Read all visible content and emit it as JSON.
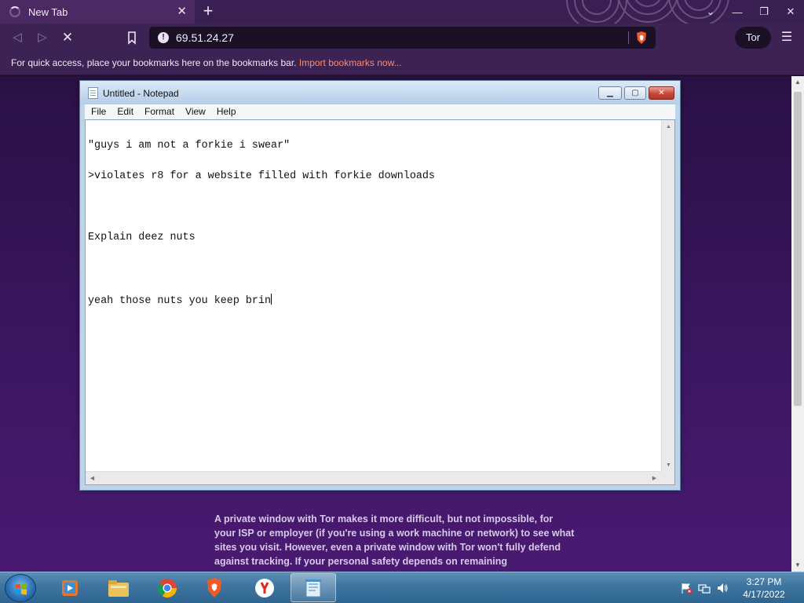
{
  "browser": {
    "tab_title": "New Tab",
    "url": "69.51.24.27",
    "tor_label": "Tor",
    "bookmarks_message": "For quick access, place your bookmarks here on the bookmarks bar.",
    "import_link": "Import bookmarks now...",
    "icons": [
      "loading-spinner",
      "close-icon",
      "plus-icon",
      "back-icon",
      "forward-icon",
      "stop-icon",
      "bookmark-icon",
      "info-icon",
      "brave-shield-icon",
      "hamburger-menu-icon"
    ]
  },
  "page": {
    "tor_notice": "A private window with Tor makes it more difficult, but not impossible, for your ISP or employer (if you're using a work machine or network) to see what sites you visit. However, even a private window with Tor won't fully defend against tracking. If your personal safety depends on remaining"
  },
  "notepad": {
    "title": "Untitled - Notepad",
    "menu": [
      "File",
      "Edit",
      "Format",
      "View",
      "Help"
    ],
    "lines": [
      "\"guys i am not a forkie i swear\"",
      ">violates r8 for a website filled with forkie downloads",
      "",
      "Explain deez nuts",
      "",
      "yeah those nuts you keep brin"
    ]
  },
  "taskbar": {
    "time": "3:27 PM",
    "date": "4/17/2022",
    "apps": [
      "media-player-icon",
      "file-explorer-icon",
      "chrome-icon",
      "brave-icon",
      "yandex-icon",
      "notepad-icon"
    ]
  },
  "colors": {
    "accent_link": "#ff8a6a",
    "browser_chrome": "#3d2354",
    "page_background": "#3a1660",
    "taskbar": "#3f77a2"
  }
}
